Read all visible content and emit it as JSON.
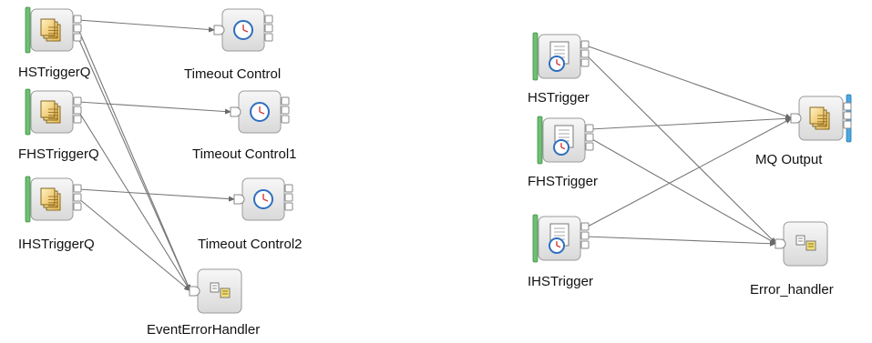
{
  "flows": [
    {
      "nodes": [
        {
          "id": "n1",
          "label": "HSTriggerQ",
          "type": "mq-input"
        },
        {
          "id": "n2",
          "label": "FHSTriggerQ",
          "type": "mq-input"
        },
        {
          "id": "n3",
          "label": "IHSTriggerQ",
          "type": "mq-input"
        },
        {
          "id": "n4",
          "label": "Timeout Control",
          "type": "timeout-control"
        },
        {
          "id": "n5",
          "label": "Timeout Control1",
          "type": "timeout-control"
        },
        {
          "id": "n6",
          "label": "Timeout Control2",
          "type": "timeout-control"
        },
        {
          "id": "n7",
          "label": "EventErrorHandler",
          "type": "subflow"
        }
      ],
      "connections": [
        {
          "from": "n1",
          "to": "n4"
        },
        {
          "from": "n2",
          "to": "n5"
        },
        {
          "from": "n3",
          "to": "n6"
        },
        {
          "from": "n1",
          "to": "n7"
        },
        {
          "from": "n1",
          "to": "n7"
        },
        {
          "from": "n2",
          "to": "n7"
        },
        {
          "from": "n3",
          "to": "n7"
        }
      ]
    },
    {
      "nodes": [
        {
          "id": "m1",
          "label": "HSTrigger",
          "type": "timeout-notification"
        },
        {
          "id": "m2",
          "label": "FHSTrigger",
          "type": "timeout-notification"
        },
        {
          "id": "m3",
          "label": "IHSTrigger",
          "type": "timeout-notification"
        },
        {
          "id": "m4",
          "label": "MQ Output",
          "type": "mq-output"
        },
        {
          "id": "m5",
          "label": "Error_handler",
          "type": "subflow"
        }
      ],
      "connections": [
        {
          "from": "m1",
          "to": "m4"
        },
        {
          "from": "m2",
          "to": "m4"
        },
        {
          "from": "m3",
          "to": "m4"
        },
        {
          "from": "m1",
          "to": "m5"
        },
        {
          "from": "m2",
          "to": "m5"
        },
        {
          "from": "m3",
          "to": "m5"
        }
      ]
    }
  ],
  "colors": {
    "input_bar": "#6fbf73",
    "output_bar": "#4aa8e0",
    "wire": "#777777",
    "node_fill": "#e6e6e6",
    "node_border": "#9a9a9a",
    "clock_ring": "#2f6fc0"
  }
}
